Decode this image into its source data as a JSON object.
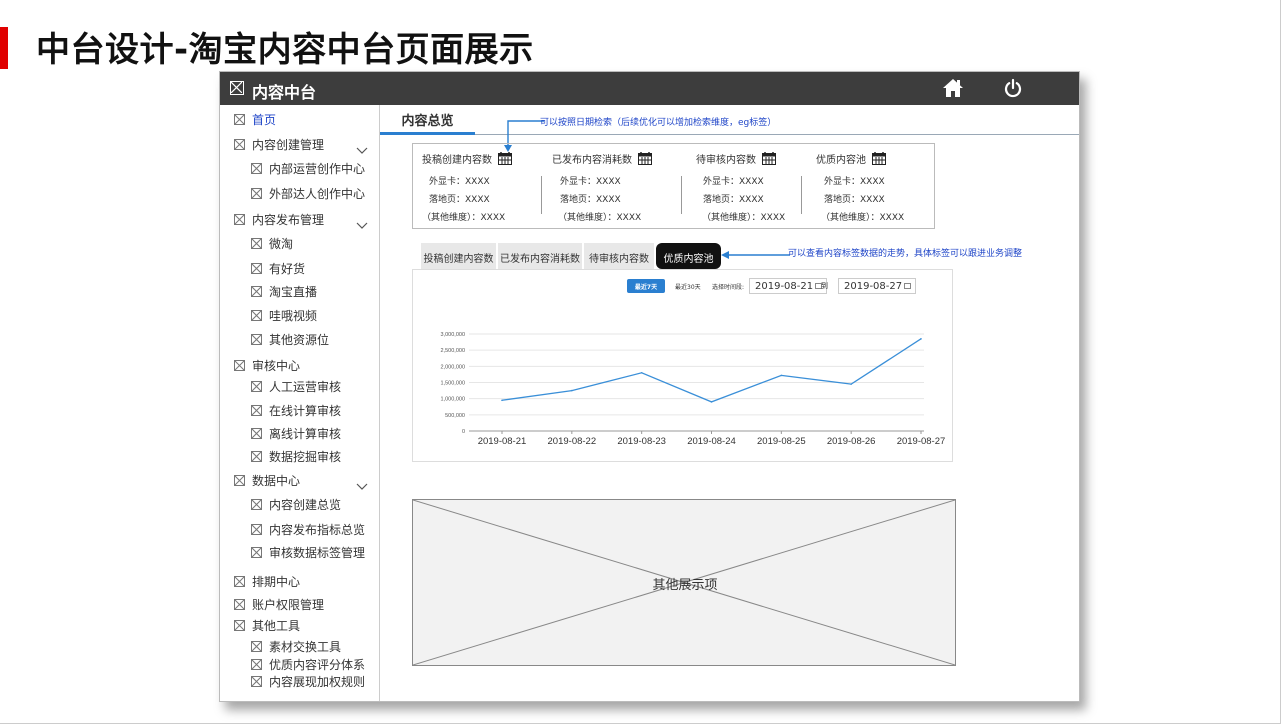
{
  "slide": {
    "title": "中台设计-淘宝内容中台页面展示"
  },
  "app": {
    "name": "内容中台",
    "icons": {
      "logo": "placeholder-x-icon",
      "home": "home-icon",
      "power": "power-icon"
    }
  },
  "sidebar": {
    "items": [
      {
        "label": "首页",
        "level": 0,
        "active": true
      },
      {
        "label": "内容创建管理",
        "level": 0,
        "chevron": true
      },
      {
        "label": "内部运营创作中心",
        "level": 1
      },
      {
        "label": "外部达人创作中心",
        "level": 1
      },
      {
        "label": "内容发布管理",
        "level": 0,
        "chevron": true
      },
      {
        "label": "微淘",
        "level": 1
      },
      {
        "label": "有好货",
        "level": 1
      },
      {
        "label": "淘宝直播",
        "level": 1
      },
      {
        "label": "哇哦视频",
        "level": 1
      },
      {
        "label": "其他资源位",
        "level": 1
      },
      {
        "label": "审核中心",
        "level": 0
      },
      {
        "label": "人工运营审核",
        "level": 1
      },
      {
        "label": "在线计算审核",
        "level": 1
      },
      {
        "label": "离线计算审核",
        "level": 1
      },
      {
        "label": "数据挖掘审核",
        "level": 1
      },
      {
        "label": "数据中心",
        "level": 0,
        "chevron": true
      },
      {
        "label": "内容创建总览",
        "level": 1
      },
      {
        "label": "内容发布指标总览",
        "level": 1
      },
      {
        "label": "审核数据标签管理",
        "level": 1
      },
      {
        "label": "排期中心",
        "level": 0
      },
      {
        "label": "账户权限管理",
        "level": 0
      },
      {
        "label": "其他工具",
        "level": 0
      },
      {
        "label": "素材交换工具",
        "level": 1
      },
      {
        "label": "优质内容评分体系",
        "level": 1
      },
      {
        "label": "内容展现加权规则",
        "level": 1
      }
    ]
  },
  "main": {
    "tab": "内容总览",
    "annotation_top": "可以按照日期检索（后续优化可以增加检索维度，eg标签）",
    "annotation_tabs": "可以查看内容标签数据的走势，具体标签可以跟进业务调整",
    "stats": [
      {
        "title": "投稿创建内容数",
        "line1": "外显卡：XXXX",
        "line2": "落地页：XXXX",
        "line3": "（其他维度）：XXXX"
      },
      {
        "title": "已发布内容消耗数",
        "line1": "外显卡：XXXX",
        "line2": "落地页：XXXX",
        "line3": "（其他维度）：XXXX"
      },
      {
        "title": "待审核内容数",
        "line1": "外显卡：XXXX",
        "line2": "落地页：XXXX",
        "line3": "（其他维度）：XXXX"
      },
      {
        "title": "优质内容池",
        "line1": "外显卡：XXXX",
        "line2": "落地页：XXXX",
        "line3": "（其他维度）：XXXX"
      }
    ],
    "chart_tabs": [
      "投稿创建内容数",
      "已发布内容消耗数",
      "待审核内容数",
      "优质内容池"
    ],
    "active_chart_tab": 3,
    "filters": {
      "btn_7": "最近7天",
      "btn_30": "最近30天",
      "label": "选择时间段:",
      "start_date": "2019-08-21",
      "to": "到",
      "end_date": "2019-08-27"
    },
    "placeholder": "其他展示项"
  },
  "chart_data": {
    "type": "line",
    "categories": [
      "2019-08-21",
      "2019-08-22",
      "2019-08-23",
      "2019-08-24",
      "2019-08-25",
      "2019-08-26",
      "2019-08-27"
    ],
    "series": [
      {
        "values": [
          950000,
          1250000,
          1800000,
          900000,
          1720000,
          1450000,
          2850000
        ]
      }
    ],
    "ylim": [
      0,
      3000000
    ],
    "yticks": [
      "3,000,000",
      "2,500,000",
      "2,000,000",
      "1,500,000",
      "1,000,000",
      "500,000",
      "0"
    ],
    "ytick_values": [
      3000000,
      2500000,
      2000000,
      1500000,
      1000000,
      500000,
      0
    ],
    "grid": true,
    "line_color": "#3a8fd8"
  }
}
